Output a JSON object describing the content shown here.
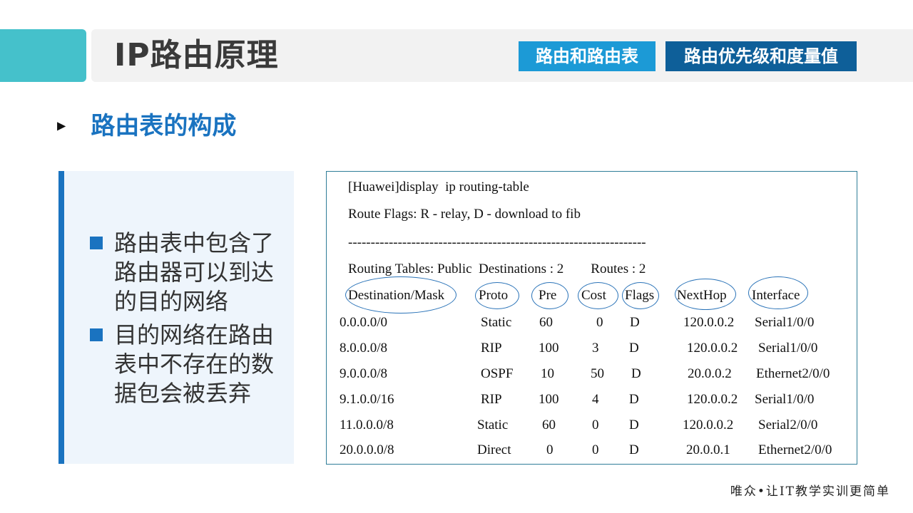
{
  "header": {
    "title": "IP路由原理",
    "tabs": [
      {
        "label": "路由和路由表"
      },
      {
        "label": "路由优先级和度量值"
      }
    ]
  },
  "section": {
    "heading": "路由表的构成",
    "arrow": "▶"
  },
  "left_panel": {
    "bullets": [
      "路由表中包含了路由器可以到达的目的网络",
      "目的网络在路由表中不存在的数据包会被丢弃"
    ]
  },
  "routing_table": {
    "command": "[Huawei]display  ip routing-table",
    "flags_line": "Route Flags: R - relay, D - download to fib",
    "separator": "------------------------------------------------------------------",
    "summary": "Routing Tables: Public  Destinations : 2        Routes : 2",
    "headers": [
      "Destination/Mask",
      "Proto",
      "Pre",
      "Cost",
      "Flags",
      "NextHop",
      "Interface"
    ],
    "rows": [
      [
        "0.0.0.0/0",
        "Static",
        "60",
        "0",
        "D",
        "120.0.0.2",
        "Serial1/0/0"
      ],
      [
        "8.0.0.0/8",
        "RIP",
        "100",
        "3",
        "D",
        "120.0.0.2",
        "Serial1/0/0"
      ],
      [
        "9.0.0.0/8",
        "OSPF",
        "10",
        "50",
        "D",
        "20.0.0.2",
        "Ethernet2/0/0"
      ],
      [
        "9.1.0.0/16",
        "RIP",
        "100",
        "4",
        "D",
        "120.0.0.2",
        "Serial1/0/0"
      ],
      [
        "11.0.0.0/8",
        "Static",
        "60",
        "0",
        "D",
        "120.0.0.2",
        "Serial2/0/0"
      ],
      [
        "20.0.0.0/8",
        "Direct",
        "0",
        "0",
        "D",
        "20.0.0.1",
        "Ethernet2/0/0"
      ]
    ]
  },
  "footer": {
    "slogan": "唯众•让IT教学实训更简单"
  },
  "colors": {
    "accent_teal": "#45c1cb",
    "tab_light": "#1c9ad6",
    "tab_dark": "#0e5f99",
    "heading_blue": "#1a73c0"
  }
}
